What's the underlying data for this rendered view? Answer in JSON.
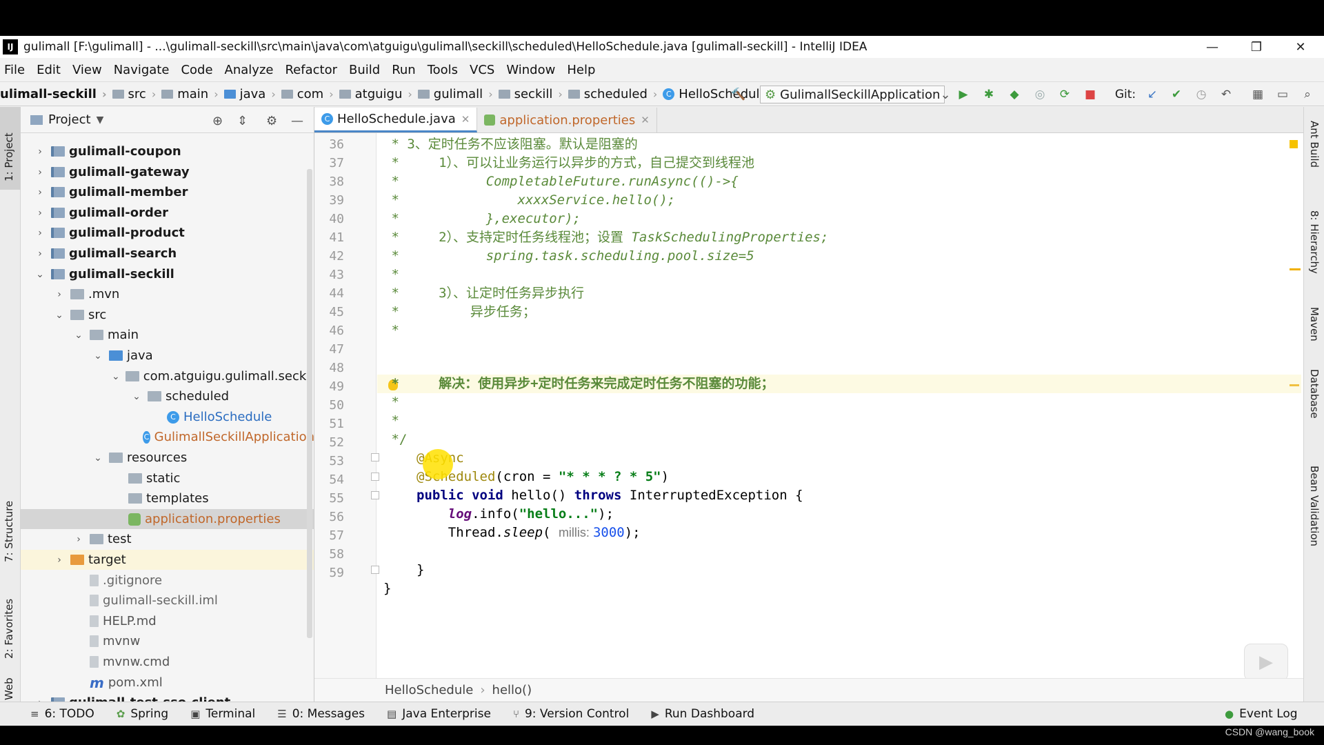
{
  "window": {
    "title": "gulimall [F:\\gulimall] - ...\\gulimall-seckill\\src\\main\\java\\com\\atguigu\\gulimall\\seckill\\scheduled\\HelloSchedule.java [gulimall-seckill] - IntelliJ IDEA",
    "logo": "IJ"
  },
  "menu": [
    "File",
    "Edit",
    "View",
    "Navigate",
    "Code",
    "Analyze",
    "Refactor",
    "Build",
    "Run",
    "Tools",
    "VCS",
    "Window",
    "Help"
  ],
  "navbar": {
    "module": "ulimall-seckill",
    "crumbs": [
      "src",
      "main",
      "java",
      "com",
      "atguigu",
      "gulimall",
      "seckill",
      "scheduled"
    ],
    "class_crumb": "HelloSchedule",
    "run_config": "GulimallSeckillApplication",
    "git_label": "Git:"
  },
  "left_strip": {
    "project_tab": "1: Project",
    "structure_tab": "7: Structure",
    "favorites_tab": "2: Favorites",
    "web_tab": "Web"
  },
  "project": {
    "header": "Project",
    "tree": [
      {
        "label": "gulimall-coupon",
        "type": "module",
        "arrow": "›",
        "indent": 0
      },
      {
        "label": "gulimall-gateway",
        "type": "module",
        "arrow": "›",
        "indent": 0
      },
      {
        "label": "gulimall-member",
        "type": "module",
        "arrow": "›",
        "indent": 0
      },
      {
        "label": "gulimall-order",
        "type": "module",
        "arrow": "›",
        "indent": 0
      },
      {
        "label": "gulimall-product",
        "type": "module",
        "arrow": "›",
        "indent": 0
      },
      {
        "label": "gulimall-search",
        "type": "module",
        "arrow": "›",
        "indent": 0
      },
      {
        "label": "gulimall-seckill",
        "type": "module",
        "arrow": "⌄",
        "indent": 0
      },
      {
        "label": ".mvn",
        "type": "folder",
        "arrow": "›",
        "indent": 1
      },
      {
        "label": "src",
        "type": "folder",
        "arrow": "⌄",
        "indent": 1
      },
      {
        "label": "main",
        "type": "folder",
        "arrow": "⌄",
        "indent": 2
      },
      {
        "label": "java",
        "type": "blue",
        "arrow": "⌄",
        "indent": 3
      },
      {
        "label": "com.atguigu.gulimall.seckill",
        "type": "folder",
        "arrow": "⌄",
        "indent": 4
      },
      {
        "label": "scheduled",
        "type": "folder",
        "arrow": "⌄",
        "indent": 5
      },
      {
        "label": "HelloSchedule",
        "type": "class",
        "arrow": "",
        "indent": 6
      },
      {
        "label": "GulimallSeckillApplication",
        "type": "class",
        "arrow": "",
        "indent": 5
      },
      {
        "label": "resources",
        "type": "folder",
        "arrow": "⌄",
        "indent": 3
      },
      {
        "label": "static",
        "type": "folder",
        "arrow": "",
        "indent": 4
      },
      {
        "label": "templates",
        "type": "folder",
        "arrow": "",
        "indent": 4
      },
      {
        "label": "application.properties",
        "type": "props",
        "arrow": "",
        "indent": 4
      },
      {
        "label": "test",
        "type": "folder",
        "arrow": "›",
        "indent": 2
      },
      {
        "label": "target",
        "type": "orange",
        "arrow": "›",
        "indent": 1
      },
      {
        "label": ".gitignore",
        "type": "file",
        "arrow": "",
        "indent": 2
      },
      {
        "label": "gulimall-seckill.iml",
        "type": "file",
        "arrow": "",
        "indent": 2
      },
      {
        "label": "HELP.md",
        "type": "file",
        "arrow": "",
        "indent": 2
      },
      {
        "label": "mvnw",
        "type": "file",
        "arrow": "",
        "indent": 2
      },
      {
        "label": "mvnw.cmd",
        "type": "file",
        "arrow": "",
        "indent": 2
      },
      {
        "label": "pom.xml",
        "type": "maven",
        "arrow": "",
        "indent": 2
      },
      {
        "label": "gulimall-test-sso-client",
        "type": "module",
        "arrow": "›",
        "indent": 0
      }
    ]
  },
  "tabs": [
    {
      "label": "HelloSchedule.java",
      "active": true
    },
    {
      "label": "application.properties",
      "active": false
    }
  ],
  "code": {
    "line_numbers": [
      "36",
      "37",
      "38",
      "39",
      "40",
      "41",
      "42",
      "43",
      "44",
      "45",
      "46",
      "47",
      "48",
      "49",
      "50",
      "51",
      "52",
      "53",
      "54",
      "55",
      "56",
      "57",
      "58",
      "59"
    ],
    "l36": " * 3、定时任务不应该阻塞。默认是阻塞的",
    "l37": " *     1）、可以让业务运行以异步的方式，自己提交到线程池",
    "l38a": " *           ",
    "l38b": "CompletableFuture.runAsync(()->{",
    "l39a": " *               ",
    "l39b": "xxxxService.hello();",
    "l40a": " *           ",
    "l40b": "},executor);",
    "l41a": " *     2）、支持定时任务线程池；设置 ",
    "l41b": "TaskSchedulingProperties;",
    "l42a": " *           ",
    "l42b": "spring.task.scheduling.pool.size=5",
    "l43": " *",
    "l44": " *     3）、让定时任务异步执行",
    "l45": " *         异步任务；",
    "l46": " *",
    "l47": " *     解决：使用异步+定时任务来完成定时任务不阻塞的功能；",
    "l48": " *",
    "l49": " *",
    "l50": " */",
    "l51": "@Async",
    "l52a": "@Scheduled",
    "l52b": "(cron = ",
    "l52c": "\"* * * ? * 5\"",
    "l52d": ")",
    "l53a": "public void ",
    "l53b": "hello() ",
    "l53c": "throws ",
    "l53d": "InterruptedException {",
    "l54a": "    ",
    "l54b": "log",
    "l54c": ".info(",
    "l54d": "\"hello...\"",
    "l54e": ");",
    "l55a": "    Thread.",
    "l55b": "sleep",
    "l55c": "( ",
    "l55d": "millis: ",
    "l55e": "3000",
    "l55f": ");",
    "l57": "}",
    "l58": "}"
  },
  "editor_breadcrumb": {
    "class": "HelloSchedule",
    "method": "hello()"
  },
  "right_strip": [
    "Ant Build",
    "8: Hierarchy",
    "Maven",
    "Database",
    "Bean Validation"
  ],
  "bottom_tools": [
    {
      "label": "6: TODO",
      "icon": "≡"
    },
    {
      "label": "Spring",
      "icon": "✿"
    },
    {
      "label": "Terminal",
      "icon": "▣"
    },
    {
      "label": "0: Messages",
      "icon": "☰"
    },
    {
      "label": "Java Enterprise",
      "icon": "▤"
    },
    {
      "label": "9: Version Control",
      "icon": "⑂"
    },
    {
      "label": "Run Dashboard",
      "icon": "▶"
    }
  ],
  "event_log": "Event Log",
  "watermark": "CSDN @wang_book"
}
